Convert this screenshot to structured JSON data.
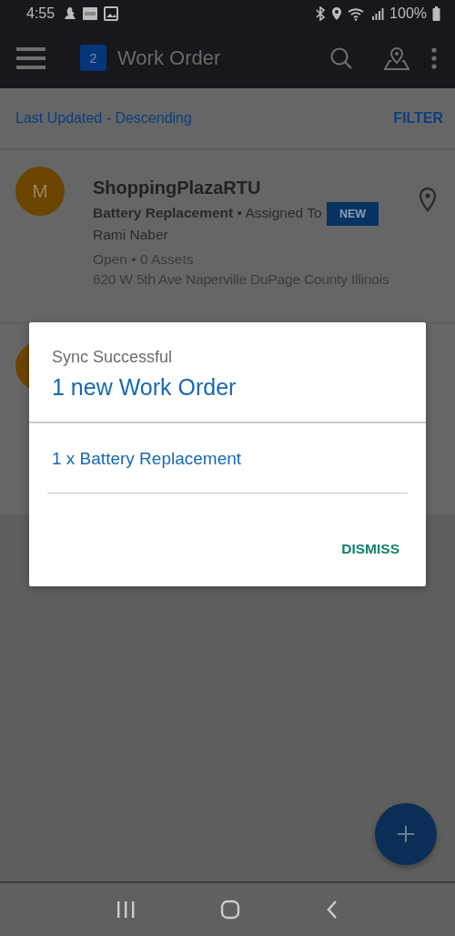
{
  "status_bar": {
    "time": "4:55",
    "battery": "100%"
  },
  "app_bar": {
    "badge": "2",
    "title": "Work Order"
  },
  "sort_bar": {
    "sort": "Last Updated - Descending",
    "filter": "FILTER"
  },
  "work_orders": [
    {
      "avatar": "M",
      "name": "ShoppingPlazaRTU",
      "summary": "**Battery Replacement** • Assigned To Rami Naber",
      "badge": "NEW",
      "status": "Open • 0 Assets",
      "address": "620 W 5th Ave Naperville DuPage County Illinois"
    }
  ],
  "dialog": {
    "caption": "Sync Successful",
    "title": "1 new Work Order",
    "items": [
      "1 x Battery Replacement"
    ],
    "action": "DISMISS"
  }
}
